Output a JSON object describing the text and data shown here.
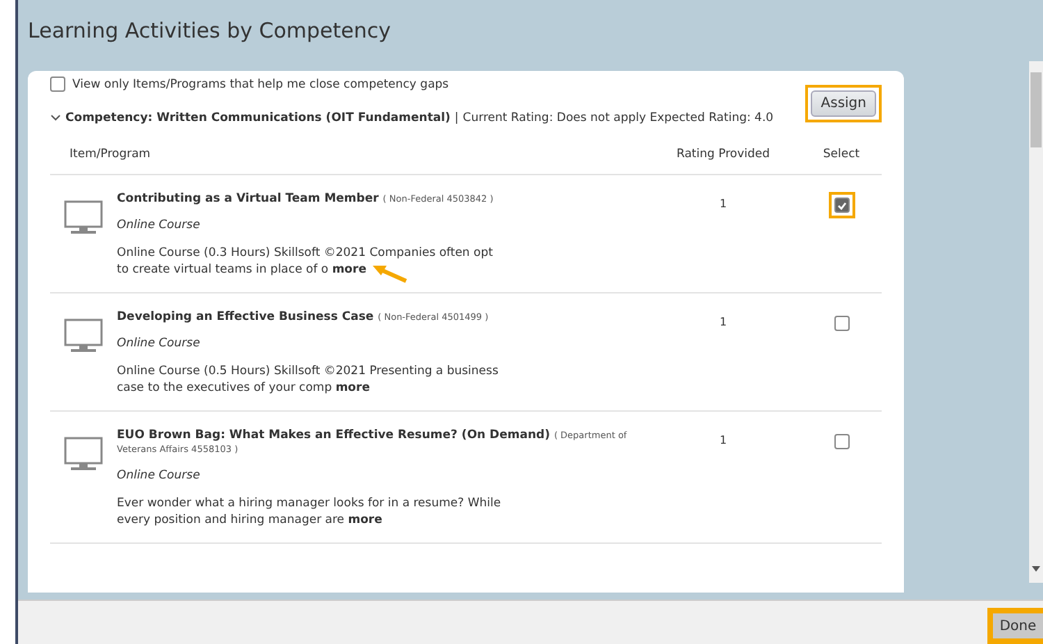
{
  "window": {
    "title": "Learning Activities by Competency"
  },
  "filter": {
    "label": "View only Items/Programs that help me close competency gaps",
    "checked": false
  },
  "assign_button": {
    "label": "Assign",
    "highlighted": true
  },
  "competency": {
    "expanded": true,
    "name": "Competency: Written Communications (OIT Fundamental)",
    "separator": "|",
    "ratings": "Current Rating: Does not apply Expected Rating: 4.0"
  },
  "table": {
    "columns": [
      "Item/Program",
      "Rating Provided",
      "Select"
    ],
    "rows": [
      {
        "title": "Contributing as a Virtual Team Member",
        "source": "( Non-Federal 4503842 )",
        "type": "Online Course",
        "description": "Online Course (0.3 Hours) Skillsoft ©2021 Companies often opt to create virtual teams in place of o",
        "more": "more",
        "pointed": true,
        "rating": "1",
        "selected": true,
        "highlighted": true
      },
      {
        "title": "Developing an Effective Business Case",
        "source": "( Non-Federal 4501499 )",
        "type": "Online Course",
        "description": "Online Course (0.5 Hours) Skillsoft ©2021 Presenting a business case to the executives of your comp",
        "more": "more",
        "pointed": false,
        "rating": "1",
        "selected": false,
        "highlighted": false
      },
      {
        "title": "EUO Brown Bag: What Makes an Effective Resume? (On Demand)",
        "source": "( Department of Veterans Affairs 4558103 )",
        "type": "Online Course",
        "description": "Ever wonder what a hiring manager looks for in a resume? While every position and hiring manager are",
        "more": "more",
        "pointed": false,
        "rating": "1",
        "selected": false,
        "highlighted": false
      }
    ]
  },
  "done_button": {
    "label": "Done",
    "highlighted": true
  }
}
